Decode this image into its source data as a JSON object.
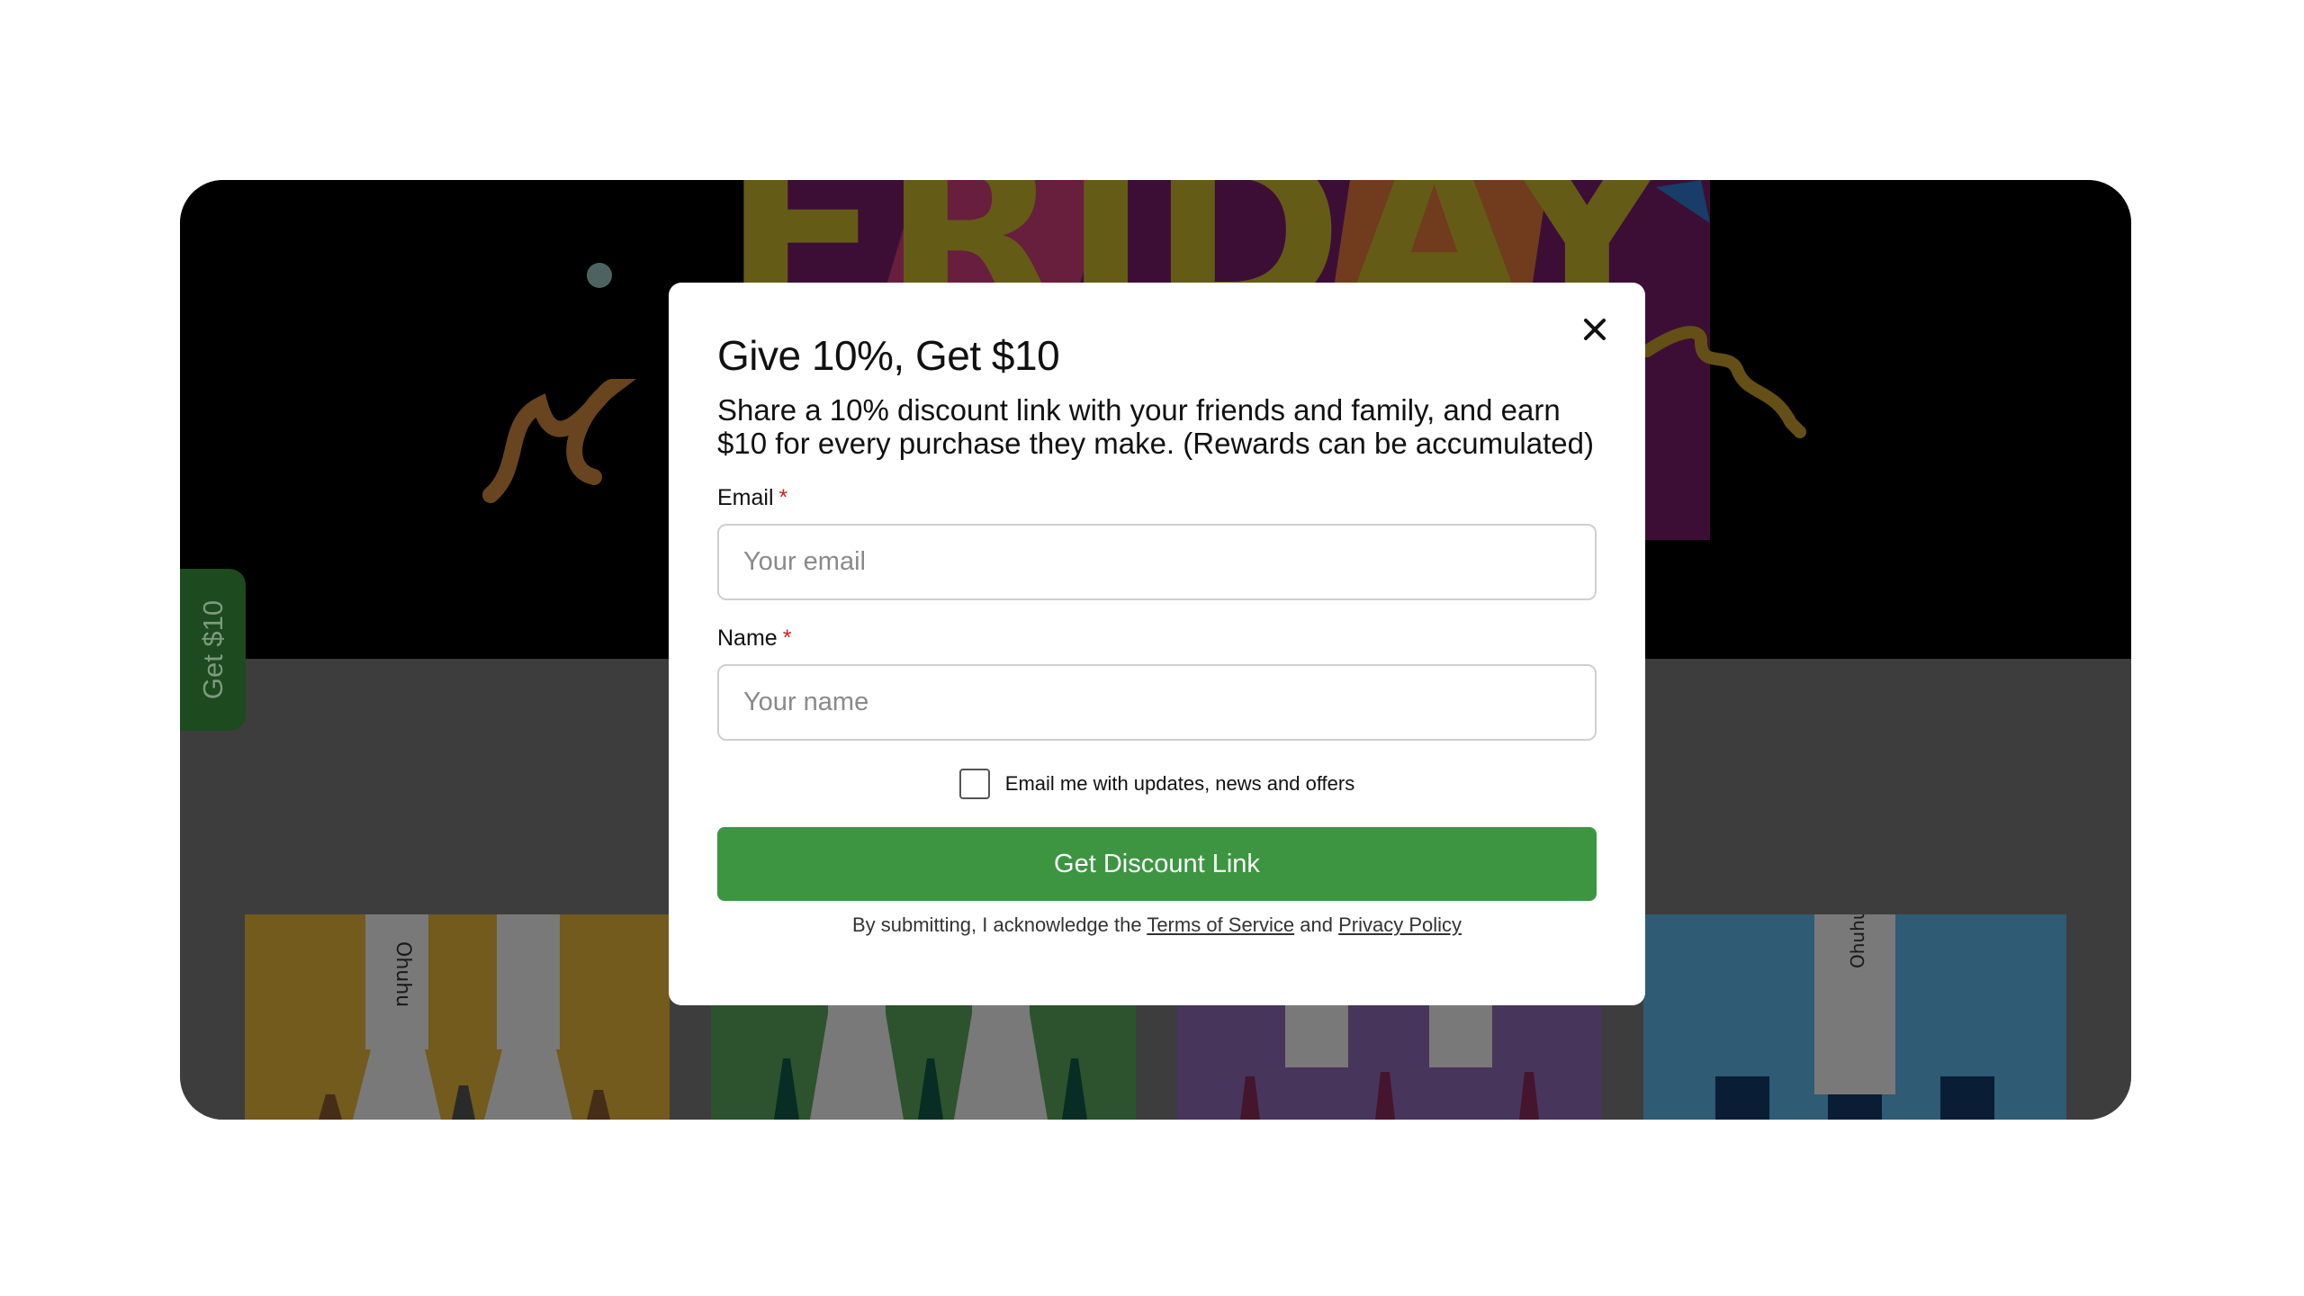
{
  "modal": {
    "title": "Give 10%, Get $10",
    "subtitle": "Share a 10% discount link with your friends and family, and earn $10 for every purchase they make. (Rewards can be accumulated)",
    "close_icon": "close-icon",
    "email": {
      "label": "Email",
      "required_marker": "*",
      "placeholder": "Your email",
      "value": ""
    },
    "name": {
      "label": "Name",
      "required_marker": "*",
      "placeholder": "Your name",
      "value": ""
    },
    "opt_in": {
      "label": "Email me with updates, news and offers",
      "checked": false
    },
    "submit_label": "Get Discount Link",
    "legal": {
      "prefix": "By submitting, I acknowledge the",
      "terms_link": "Terms of Service",
      "conjunction": "and",
      "privacy_link": "Privacy Policy"
    }
  },
  "side_tab": {
    "label": "Get $10"
  },
  "background": {
    "hero_text": "FRIDAY",
    "product_brand": "Ohuhu"
  },
  "colors": {
    "accent_green": "#3d9542",
    "side_tab_green": "#1d4a1f",
    "required_red": "#d32020"
  }
}
